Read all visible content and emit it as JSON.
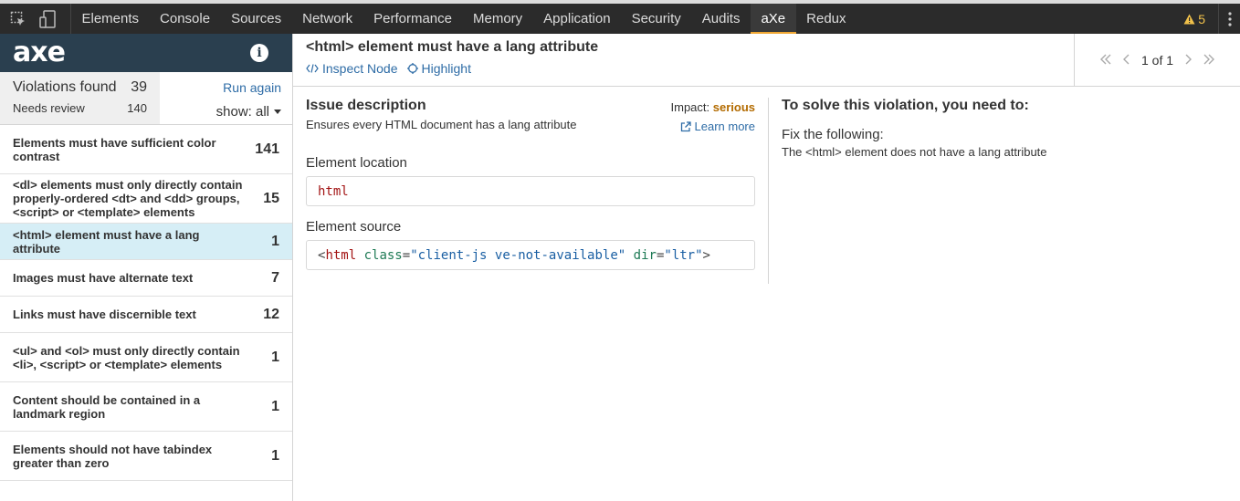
{
  "devtools": {
    "tabs": [
      "Elements",
      "Console",
      "Sources",
      "Network",
      "Performance",
      "Memory",
      "Application",
      "Security",
      "Audits",
      "aXe",
      "Redux"
    ],
    "active_tab": "aXe",
    "warning_count": "5"
  },
  "sidebar": {
    "logo": "axe",
    "violations_label": "Violations found",
    "violations_count": "39",
    "needs_review_label": "Needs review",
    "needs_review_count": "140",
    "run_again": "Run again",
    "show_filter": "show: all",
    "items": [
      {
        "label": "Elements must have sufficient color contrast",
        "count": "141"
      },
      {
        "label": "<dl> elements must only directly contain properly-ordered <dt> and <dd> groups, <script> or <template> elements",
        "count": "15"
      },
      {
        "label": "<html> element must have a lang attribute",
        "count": "1"
      },
      {
        "label": "Images must have alternate text",
        "count": "7"
      },
      {
        "label": "Links must have discernible text",
        "count": "12"
      },
      {
        "label": "<ul> and <ol> must only directly contain <li>, <script> or <template> elements",
        "count": "1"
      },
      {
        "label": "Content should be contained in a landmark region",
        "count": "1"
      },
      {
        "label": "Elements should not have tabindex greater than zero",
        "count": "1"
      }
    ],
    "active_index": 2
  },
  "main": {
    "rule_title": "<html> element must have a lang attribute",
    "inspect_node": "Inspect Node",
    "highlight": "Highlight",
    "pager": "1 of 1",
    "issue_heading": "Issue description",
    "issue_description": "Ensures every HTML document has a lang attribute",
    "impact_label": "Impact:",
    "impact_value": "serious",
    "learn_more": "Learn more",
    "location_label": "Element location",
    "location_value": "html",
    "source_label": "Element source",
    "source": {
      "open": "<",
      "tag": "html",
      "attr1": "class",
      "val1": "\"client-js ve-not-available\"",
      "attr2": "dir",
      "val2": "\"ltr\"",
      "close": ">"
    },
    "solve_heading": "To solve this violation, you need to:",
    "fix_heading": "Fix the following:",
    "fix_detail": "The <html> element does not have a lang attribute"
  },
  "colors": {
    "brand_dark": "#2a3f4f",
    "link": "#2e6ca6",
    "active_row": "#d6eef6",
    "tab_accent": "#f0a732",
    "serious": "#b36b00"
  }
}
